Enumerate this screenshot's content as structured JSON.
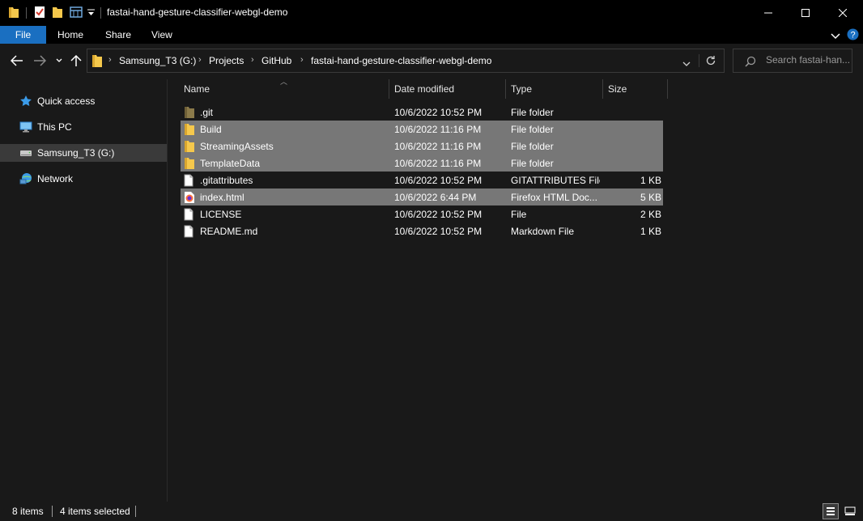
{
  "window": {
    "title": "fastai-hand-gesture-classifier-webgl-demo"
  },
  "ribbon": {
    "tabs": [
      "File",
      "Home",
      "Share",
      "View"
    ]
  },
  "address": {
    "crumbs": [
      "Samsung_T3 (G:)",
      "Projects",
      "GitHub",
      "fastai-hand-gesture-classifier-webgl-demo"
    ]
  },
  "search": {
    "placeholder": "Search fastai-han..."
  },
  "nav": {
    "items": [
      {
        "label": "Quick access",
        "icon": "star-icon"
      },
      {
        "label": "This PC",
        "icon": "computer-icon"
      },
      {
        "label": "Samsung_T3 (G:)",
        "icon": "drive-icon"
      },
      {
        "label": "Network",
        "icon": "network-icon"
      }
    ]
  },
  "columns": {
    "name": "Name",
    "date": "Date modified",
    "type": "Type",
    "size": "Size"
  },
  "files": [
    {
      "name": ".git",
      "date": "10/6/2022 10:52 PM",
      "type": "File folder",
      "size": "",
      "icon": "folder-dark-icon",
      "selected": false
    },
    {
      "name": "Build",
      "date": "10/6/2022 11:16 PM",
      "type": "File folder",
      "size": "",
      "icon": "folder-icon",
      "selected": true
    },
    {
      "name": "StreamingAssets",
      "date": "10/6/2022 11:16 PM",
      "type": "File folder",
      "size": "",
      "icon": "folder-icon",
      "selected": true
    },
    {
      "name": "TemplateData",
      "date": "10/6/2022 11:16 PM",
      "type": "File folder",
      "size": "",
      "icon": "folder-icon",
      "selected": true
    },
    {
      "name": ".gitattributes",
      "date": "10/6/2022 10:52 PM",
      "type": "GITATTRIBUTES File",
      "size": "1 KB",
      "icon": "file-icon",
      "selected": false
    },
    {
      "name": "index.html",
      "date": "10/6/2022 6:44 PM",
      "type": "Firefox HTML Doc...",
      "size": "5 KB",
      "icon": "firefox-icon",
      "selected": true
    },
    {
      "name": "LICENSE",
      "date": "10/6/2022 10:52 PM",
      "type": "File",
      "size": "2 KB",
      "icon": "file-icon",
      "selected": false
    },
    {
      "name": "README.md",
      "date": "10/6/2022 10:52 PM",
      "type": "Markdown File",
      "size": "1 KB",
      "icon": "file-icon",
      "selected": false
    }
  ],
  "status": {
    "count": "8 items",
    "selected": "4 items selected"
  },
  "colors": {
    "accent": "#1a6fc1",
    "selection": "#777777",
    "folder": "#f5c84c"
  }
}
